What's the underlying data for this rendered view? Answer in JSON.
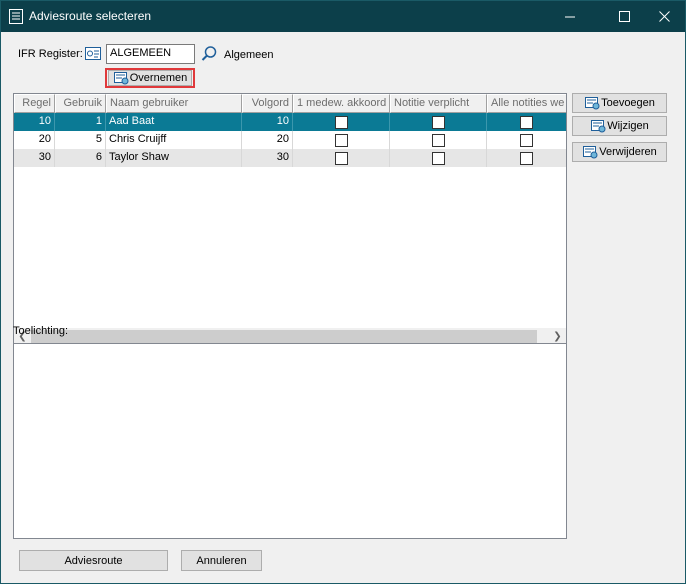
{
  "window": {
    "title": "Adviesroute selecteren",
    "app_icon": "document-list-icon",
    "controls": [
      "minimize-icon",
      "maximize-icon",
      "close-icon"
    ]
  },
  "register": {
    "label": "IFR Register:",
    "value": "ALGEMEEN",
    "description": "Algemeen",
    "overnemen_label": "Overnemen"
  },
  "grid": {
    "columns": [
      "Regel",
      "Gebruik",
      "Naam gebruiker",
      "Volgord",
      "1 medew. akkoord",
      "Notitie verplicht",
      "Alle notities we"
    ],
    "rows": [
      {
        "regel": "10",
        "gebruiker": "1",
        "naam": "Aad Baat",
        "volgorde": "10",
        "akkoord": false,
        "notitie": false,
        "alle": false,
        "selected": true
      },
      {
        "regel": "20",
        "gebruiker": "5",
        "naam": "Chris Cruijff",
        "volgorde": "20",
        "akkoord": false,
        "notitie": false,
        "alle": false,
        "selected": false
      },
      {
        "regel": "30",
        "gebruiker": "6",
        "naam": "Taylor Shaw",
        "volgorde": "30",
        "akkoord": false,
        "notitie": false,
        "alle": false,
        "selected": false
      }
    ]
  },
  "side_buttons": {
    "toevoegen": "Toevoegen",
    "wijzigen": "Wijzigen",
    "verwijderen": "Verwijderen"
  },
  "toelichting": {
    "label": "Toelichting:",
    "value": ""
  },
  "footer": {
    "adviesroute": "Adviesroute",
    "annuleren": "Annuleren"
  },
  "colors": {
    "titlebar": "#0c3f4a",
    "selection": "#0b7a95",
    "highlight": "#e0393b"
  }
}
